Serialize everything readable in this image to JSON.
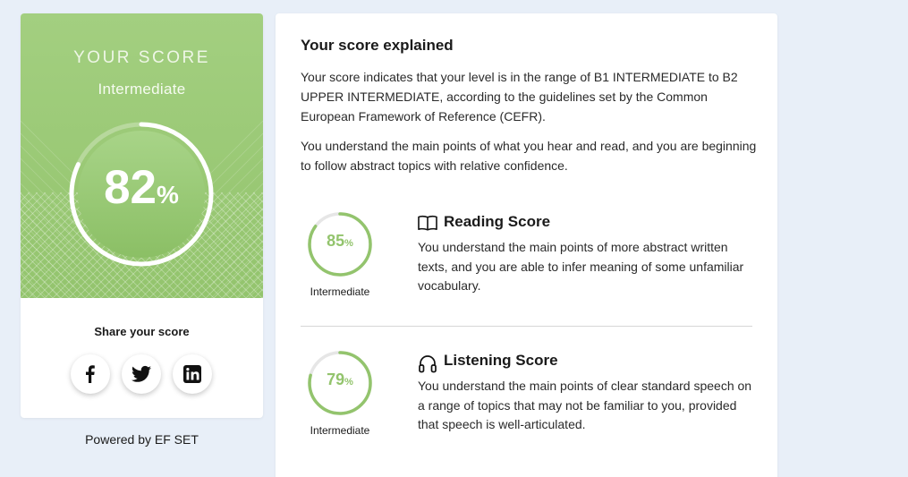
{
  "score_card": {
    "label": "YOUR SCORE",
    "level": "Intermediate",
    "score_value": 82,
    "score_number": "82",
    "percent_sign": "%",
    "share_title": "Share your score",
    "social": [
      {
        "name": "Facebook",
        "icon": "facebook-icon"
      },
      {
        "name": "Twitter",
        "icon": "twitter-icon"
      },
      {
        "name": "LinkedIn",
        "icon": "linkedin-icon"
      }
    ]
  },
  "powered_by": "Powered by EF SET",
  "explanation": {
    "title": "Your score explained",
    "paragraph1": "Your score indicates that your level is in the range of B1 INTERMEDIATE to B2 UPPER INTERMEDIATE, according to the guidelines set by the Common European Framework of Reference (CEFR).",
    "paragraph2": "You understand the main points of what you hear and read, and you are beginning to follow abstract topics with relative confidence."
  },
  "reading": {
    "title": "Reading Score",
    "icon": "open-book-icon",
    "score_value": 85,
    "score_number": "85",
    "percent_sign": "%",
    "level": "Intermediate",
    "description": "You understand the main points of more abstract written texts, and you are able to infer meaning of some unfamiliar vocabulary."
  },
  "listening": {
    "title": "Listening Score",
    "icon": "headphones-icon",
    "score_value": 79,
    "score_number": "79",
    "percent_sign": "%",
    "level": "Intermediate",
    "description": "You understand the main points of clear standard speech on a range of topics that may not be familiar to you, provided that speech is well-articulated."
  },
  "colors": {
    "accent_green": "#93c46d",
    "hero_green": "#a3cf80",
    "background": "#e8eff8"
  }
}
